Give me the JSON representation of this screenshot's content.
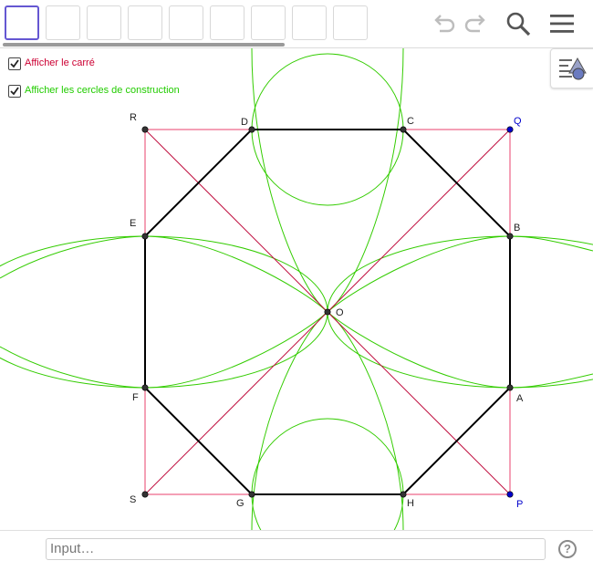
{
  "toolbar": {
    "tools": [
      {
        "name": "tool-move"
      },
      {
        "name": "tool-point"
      },
      {
        "name": "tool-line"
      },
      {
        "name": "tool-perpendicular"
      },
      {
        "name": "tool-polygon"
      },
      {
        "name": "tool-circle"
      },
      {
        "name": "tool-ellipse"
      },
      {
        "name": "tool-angle"
      },
      {
        "name": "tool-reflect"
      }
    ],
    "icons": [
      "undo-icon",
      "redo-icon",
      "search-icon",
      "menu-icon"
    ]
  },
  "checkboxes": {
    "square": {
      "label": "Afficher le carré",
      "checked": true,
      "color": "#cc0033"
    },
    "circles": {
      "label": "Afficher les cercles de construction",
      "checked": true,
      "color": "#22cc00"
    }
  },
  "geometry": {
    "points": {
      "R": "R",
      "D": "D",
      "C": "C",
      "Q": "Q",
      "E": "E",
      "B": "B",
      "O": "O",
      "F": "F",
      "A": "A",
      "S": "S",
      "G": "G",
      "H": "H",
      "P": "P"
    },
    "colors": {
      "square": "#f07896",
      "octagon": "#000000",
      "circles": "#33cc00",
      "diagonal": "#c01040",
      "highlight": "#0000cc"
    }
  },
  "input": {
    "placeholder": "Input…"
  },
  "help": {
    "label": "?"
  }
}
